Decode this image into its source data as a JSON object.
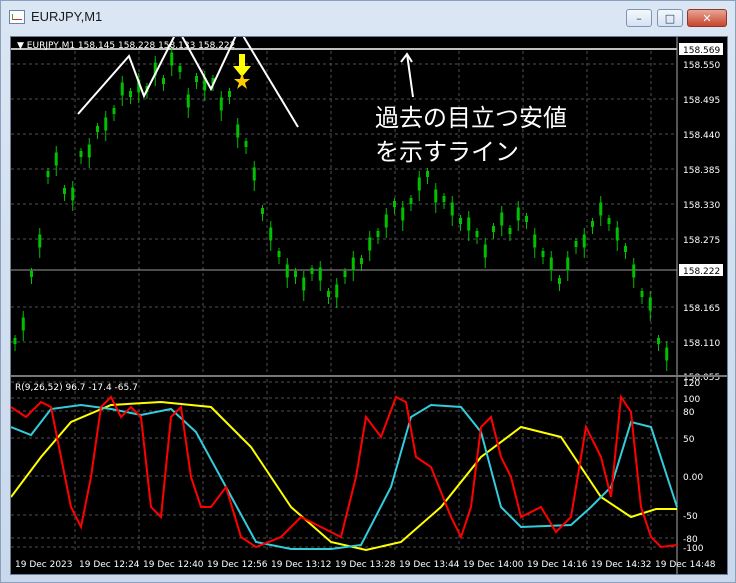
{
  "window": {
    "title": "EURJPY,M1",
    "controls": [
      "–",
      "□",
      "✕"
    ]
  },
  "main_chart": {
    "header": "EURJPY,M1  158.145 158.228 158.133 158.222",
    "price_ticks": [
      "158.550",
      "158.495",
      "158.440",
      "158.385",
      "158.330",
      "158.275",
      "158.220",
      "158.165",
      "158.110",
      "158.055"
    ],
    "highlight_high": "158.569",
    "highlight_current": "158.222",
    "annotation_line1": "過去の目立つ安値",
    "annotation_line2": "を示すライン",
    "colors": {
      "candles": "#00c000",
      "bg": "#000000",
      "grid": "#5a5a5a",
      "annotation": "#ffffff",
      "arrow": "#ffff00"
    }
  },
  "indicator": {
    "header": "R(9,26,52) 96.7 -17.4 -65.7",
    "ticks": [
      "120",
      "100",
      "80",
      "50",
      "0.00",
      "-50",
      "-80",
      "-100"
    ],
    "colors": {
      "fast": "#ff0000",
      "mid": "#33ccdd",
      "slow": "#ffff00"
    }
  },
  "time_axis": {
    "labels": [
      "19 Dec 2023",
      "19 Dec 12:24",
      "19 Dec 12:40",
      "19 Dec 12:56",
      "19 Dec 13:12",
      "19 Dec 13:28",
      "19 Dec 13:44",
      "19 Dec 14:00",
      "19 Dec 14:16",
      "19 Dec 14:32",
      "19 Dec 14:48"
    ]
  }
}
